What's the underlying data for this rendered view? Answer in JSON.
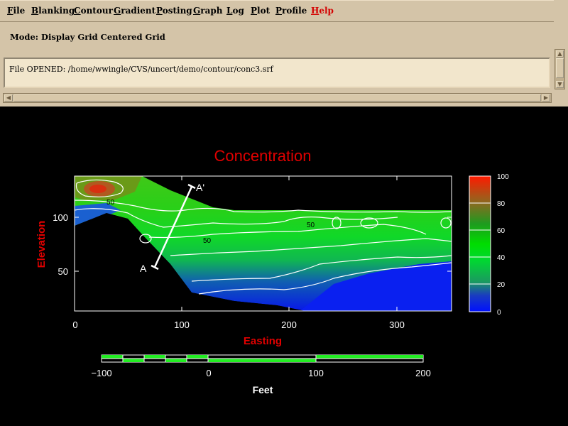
{
  "menubar": {
    "items": [
      "File",
      "Blanking",
      "Contour",
      "Gradient",
      "Posting",
      "Graph",
      "Log",
      "Plot",
      "Profile",
      "Help"
    ]
  },
  "mode": {
    "text": "Mode: Display Grid Centered Grid"
  },
  "message": {
    "text": "File OPENED: /home/wwingle/CVS/uncert/demo/contour/conc3.srf"
  },
  "plot": {
    "title": "Concentration",
    "title_color": "#e00000",
    "xlabel": "Easting",
    "ylabel": "Elevation",
    "x_ticks": [
      "0",
      "100",
      "200",
      "300"
    ],
    "y_ticks": [
      "100",
      "50"
    ],
    "contour_labels": [
      "50",
      "50",
      "50"
    ],
    "profile_start_label": "A",
    "profile_end_label": "A'"
  },
  "colorbar": {
    "ticks": [
      "100",
      "80",
      "60",
      "40",
      "20",
      "0"
    ],
    "colors": [
      "#ff1a00",
      "#8a6a20",
      "#1f9a1f",
      "#00dd00",
      "#1a9a60",
      "#1a3cc0",
      "#0010ff"
    ]
  },
  "scalebar": {
    "ticks": [
      "−100",
      "0",
      "100",
      "200"
    ],
    "label": "Feet",
    "fill_color": "#22ee22"
  },
  "colors": {
    "label_red": "#e00000",
    "chrome_bg": "#d4c4a8",
    "help_red": "#d40000"
  }
}
